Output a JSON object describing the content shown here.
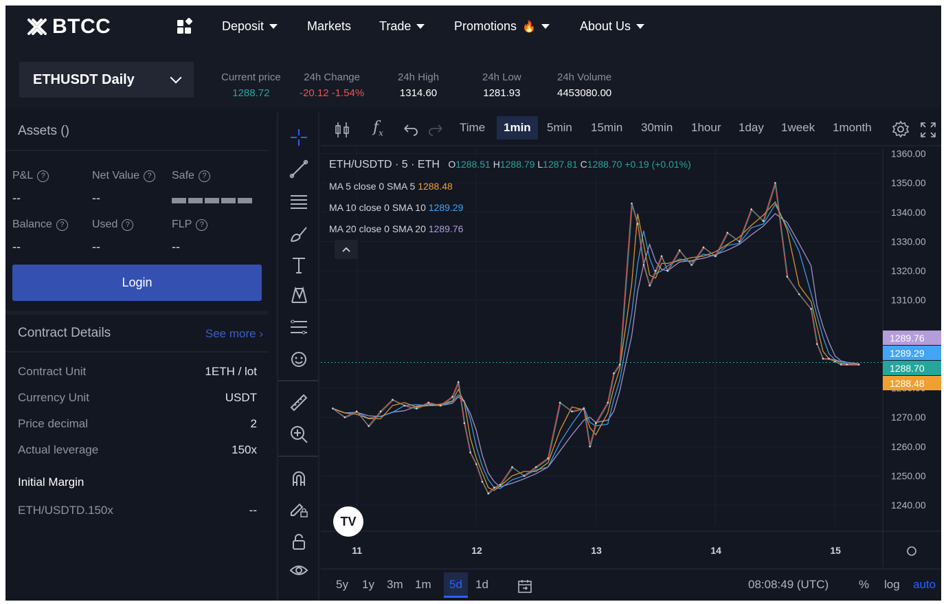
{
  "brand": {
    "name": "BTCC"
  },
  "nav": {
    "items": [
      {
        "label": "Deposit",
        "dropdown": true
      },
      {
        "label": "Markets",
        "dropdown": false
      },
      {
        "label": "Trade",
        "dropdown": true
      },
      {
        "label": "Promotions",
        "dropdown": true
      },
      {
        "label": "About Us",
        "dropdown": true
      }
    ]
  },
  "ticker": {
    "symbol": "ETHUSDT Daily",
    "stats": [
      {
        "label": "Current price",
        "value": "1288.72"
      },
      {
        "label": "24h Change",
        "value": "-20.12 -1.54%"
      },
      {
        "label": "24h High",
        "value": "1314.60"
      },
      {
        "label": "24h Low",
        "value": "1281.93"
      },
      {
        "label": "24h Volume",
        "value": "4453080.00"
      }
    ]
  },
  "assets": {
    "title": "Assets ()",
    "pnl_label": "P&L",
    "pnl_value": "--",
    "net_label": "Net Value",
    "net_value": "--",
    "safe_label": "Safe",
    "balance_label": "Balance",
    "balance_value": "--",
    "used_label": "Used",
    "used_value": "--",
    "flp_label": "FLP",
    "flp_value": "--",
    "login_label": "Login"
  },
  "contract": {
    "title": "Contract Details",
    "see_more": "See more",
    "rows": [
      {
        "k": "Contract Unit",
        "v": "1ETH / lot"
      },
      {
        "k": "Currency Unit",
        "v": "USDT"
      },
      {
        "k": "Price decimal",
        "v": "2"
      },
      {
        "k": "Actual leverage",
        "v": "150x"
      }
    ],
    "initial_margin_title": "Initial Margin",
    "margin_row": {
      "k": "ETH/USDTD.150x",
      "v": "--"
    }
  },
  "chart_toolbar": {
    "fx": "f",
    "intervals": [
      "Time",
      "1min",
      "5min",
      "15min",
      "30min",
      "1hour",
      "1day",
      "1week",
      "1month"
    ],
    "active_interval": "1min"
  },
  "legend": {
    "symbol": "ETH/USDTD · 5 · ETH",
    "o_label": "O",
    "o": "1288.51",
    "h_label": "H",
    "h": "1288.79",
    "l_label": "L",
    "l": "1287.81",
    "c_label": "C",
    "c": "1288.70",
    "change": "+0.19 (+0.01%)",
    "ma5_label": "MA 5 close 0 SMA 5",
    "ma5": "1288.48",
    "ma10_label": "MA 10 close 0 SMA 10",
    "ma10": "1289.29",
    "ma20_label": "MA 20 close 0 SMA 20",
    "ma20": "1289.76"
  },
  "chart_data": {
    "type": "line",
    "x_ticks": [
      "11",
      "12",
      "13",
      "14",
      "15"
    ],
    "y_ticks": [
      "1360.00",
      "1350.00",
      "1340.00",
      "1330.00",
      "1320.00",
      "1310.00",
      "1280.00",
      "1270.00",
      "1260.00",
      "1250.00",
      "1240.00"
    ],
    "ylim": [
      1233,
      1362
    ],
    "price_labels": [
      {
        "value": "1289.76",
        "color": "#b39ddb"
      },
      {
        "value": "1289.29",
        "color": "#42a5f5"
      },
      {
        "value": "1288.70",
        "color": "#26a69a"
      },
      {
        "value": "1288.48",
        "color": "#f0a030"
      }
    ],
    "series": [
      {
        "name": "ETH/USDTD",
        "x": [
          10.8,
          10.9,
          11.0,
          11.1,
          11.2,
          11.3,
          11.4,
          11.5,
          11.6,
          11.7,
          11.8,
          11.85,
          11.9,
          11.95,
          12.0,
          12.05,
          12.1,
          12.15,
          12.2,
          12.3,
          12.4,
          12.5,
          12.6,
          12.7,
          12.8,
          12.9,
          12.95,
          13.0,
          13.1,
          13.15,
          13.2,
          13.3,
          13.35,
          13.4,
          13.45,
          13.5,
          13.55,
          13.6,
          13.7,
          13.8,
          13.9,
          14.0,
          14.1,
          14.2,
          14.3,
          14.4,
          14.5,
          14.6,
          14.7,
          14.8,
          14.85,
          14.9,
          14.95,
          15.0,
          15.05,
          15.1,
          15.2
        ],
        "values": [
          1273,
          1270,
          1272,
          1267,
          1272,
          1276,
          1274,
          1273,
          1275,
          1274,
          1277,
          1282,
          1268,
          1258,
          1254,
          1248,
          1244,
          1246,
          1247,
          1253,
          1250,
          1253,
          1256,
          1275,
          1272,
          1273,
          1260,
          1268,
          1275,
          1285,
          1288,
          1343,
          1336,
          1322,
          1315,
          1320,
          1325,
          1320,
          1327,
          1322,
          1328,
          1325,
          1333,
          1330,
          1341,
          1337,
          1350,
          1318,
          1312,
          1307,
          1295,
          1290,
          1290,
          1289,
          1288,
          1288,
          1288
        ]
      }
    ]
  },
  "bottom": {
    "ranges": [
      "5y",
      "1y",
      "3m",
      "1m",
      "5d",
      "1d"
    ],
    "active_range": "5d",
    "time": "08:08:49 (UTC)",
    "percent": "%",
    "log": "log",
    "auto": "auto"
  },
  "colors": {
    "bg": "#131722",
    "accent": "#2962ff",
    "login": "#3451b2",
    "up": "#26a69a",
    "down": "#ef5350",
    "ma5": "#f0a030",
    "ma10": "#42a5f5",
    "ma20": "#b39ddb"
  }
}
